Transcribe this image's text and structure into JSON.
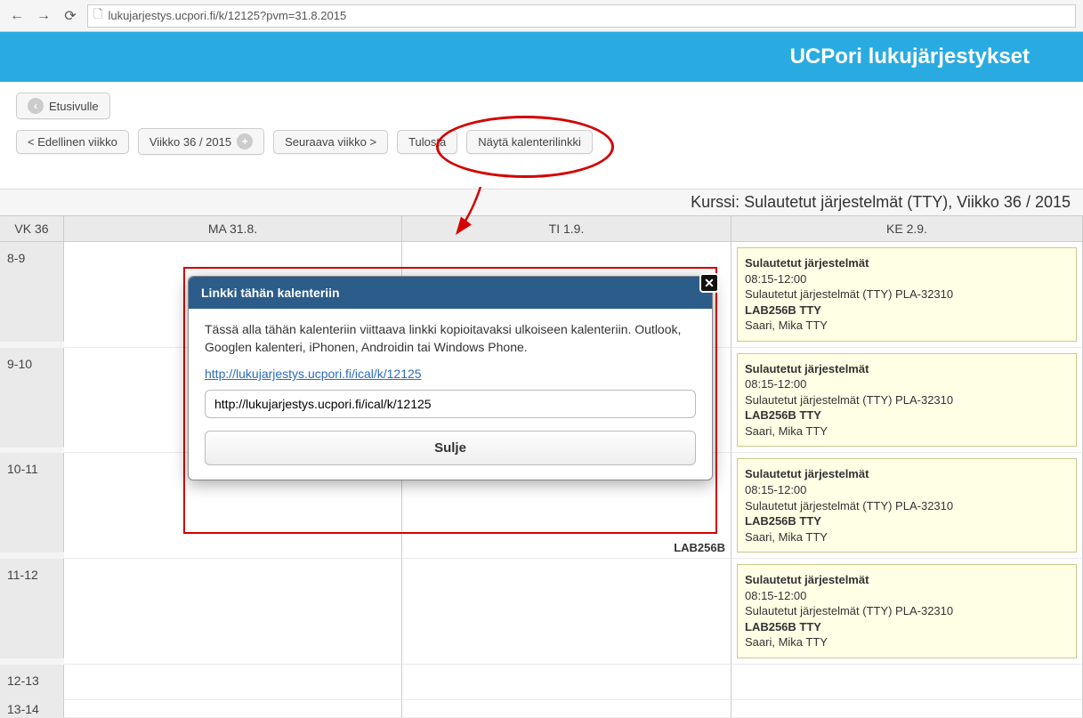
{
  "browser": {
    "url": "lukujarjestys.ucpori.fi/k/12125?pvm=31.8.2015"
  },
  "header": {
    "title": "UCPori lukujärjestykset"
  },
  "toolbar": {
    "home": "Etusivulle",
    "prev_week": "< Edellinen viikko",
    "week_label": "Viikko 36 / 2015",
    "next_week": "Seuraava viikko >",
    "print": "Tulosta",
    "show_calendar_link": "Näytä kalenterilinkki"
  },
  "schedule": {
    "title": "Kurssi: Sulautetut järjestelmät (TTY), Viikko 36 / 2015",
    "week_col": "VK 36",
    "days": [
      "MA 31.8.",
      "TI 1.9.",
      "KE 2.9."
    ],
    "time_slots": [
      "8-9",
      "9-10",
      "10-11",
      "11-12",
      "12-13",
      "13-14"
    ],
    "partial_room": "LAB256B",
    "event": {
      "title": "Sulautetut järjestelmät",
      "time": "08:15-12:00",
      "desc": "Sulautetut järjestelmät (TTY) PLA-32310",
      "room": "LAB256B TTY",
      "teacher": "Saari, Mika TTY"
    }
  },
  "modal": {
    "title": "Linkki tähän kalenteriin",
    "text": "Tässä alla tähän kalenteriin viittaava linkki kopioitavaksi ulkoiseen kalenteriin. Outlook, Googlen kalenteri, iPhonen, Androidin tai Windows Phone.",
    "link": "http://lukujarjestys.ucpori.fi/ical/k/12125",
    "input_value": "http://lukujarjestys.ucpori.fi/ical/k/12125",
    "close_btn": "Sulje"
  }
}
